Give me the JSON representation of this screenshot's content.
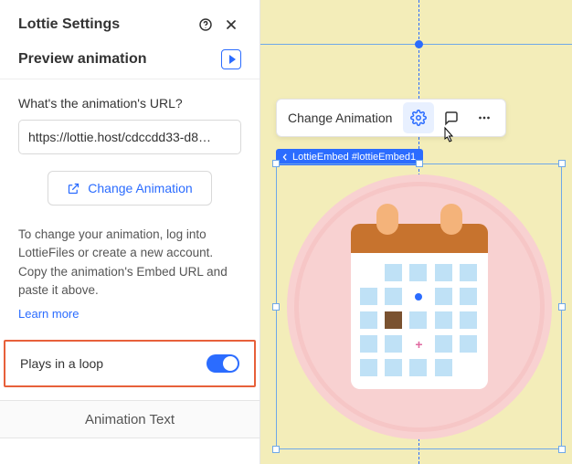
{
  "panel": {
    "title": "Lottie Settings",
    "preview_label": "Preview animation",
    "url_label": "What's the animation's URL?",
    "url_value": "https://lottie.host/cdccdd33-d8…",
    "change_button": "Change Animation",
    "help_text": "To change your animation, log into LottieFiles or create a new account. Copy the animation's Embed URL and paste it above.",
    "learn_more": "Learn more",
    "loop_label": "Plays in a loop",
    "animation_text_label": "Animation Text"
  },
  "toolbar": {
    "change_label": "Change Animation"
  },
  "tag": {
    "label": "LottieEmbed #lottieEmbed1"
  }
}
